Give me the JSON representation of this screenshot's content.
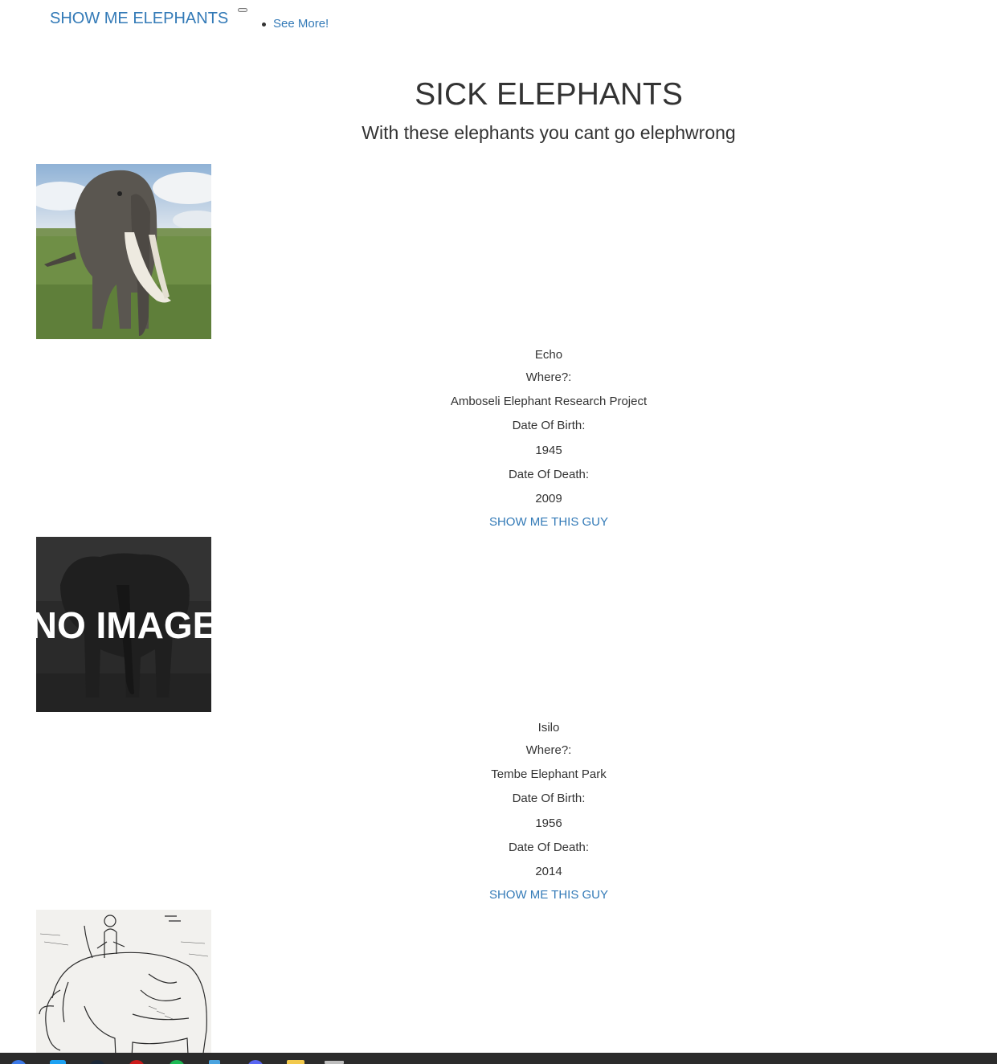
{
  "navbar": {
    "brand": "SHOW ME ELEPHANTS",
    "links": [
      {
        "label": "See More!"
      }
    ]
  },
  "hero": {
    "title": "SICK ELEPHANTS",
    "subtitle": "With these elephants you cant go elephwrong"
  },
  "labels": {
    "where": "Where?:",
    "dob": "Date Of Birth:",
    "dod": "Date Of Death:",
    "button": "SHOW ME THIS GUY",
    "no_image": "NO IMAGE"
  },
  "elephants": [
    {
      "name": "Echo",
      "where": "Amboseli Elephant Research Project",
      "dob": "1945",
      "dod": "2009",
      "image": "elephant-photo"
    },
    {
      "name": "Isilo",
      "where": "Tembe Elephant Park",
      "dob": "1956",
      "dod": "2014",
      "image": "no-image-placeholder"
    },
    {
      "image": "elephant-sketch"
    }
  ],
  "taskbar": {
    "icons": [
      "chrome-icon",
      "twitter-icon",
      "steam-icon",
      "opera-icon",
      "spotify-icon",
      "notes-icon",
      "discord-icon",
      "sticky-notes-icon",
      "window-icon"
    ]
  }
}
